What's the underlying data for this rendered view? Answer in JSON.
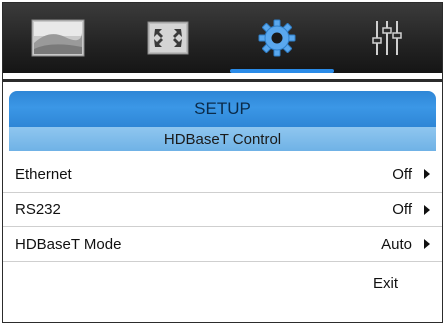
{
  "tabs": [
    {
      "icon": "image-icon",
      "active": false
    },
    {
      "icon": "fullscreen-icon",
      "active": false
    },
    {
      "icon": "gear-icon",
      "active": true
    },
    {
      "icon": "equalizer-sliders-icon",
      "active": false
    }
  ],
  "colors": {
    "accent": "#2a8be8",
    "header": "#3b97e6",
    "subheader": "#8fc6ef",
    "gear": "#5aa8ee"
  },
  "menu": {
    "title": "SETUP",
    "subtitle": "HDBaseT Control",
    "items": [
      {
        "label": "Ethernet",
        "value": "Off"
      },
      {
        "label": "RS232",
        "value": "Off"
      },
      {
        "label": "HDBaseT Mode",
        "value": "Auto"
      }
    ],
    "exit_label": "Exit"
  }
}
